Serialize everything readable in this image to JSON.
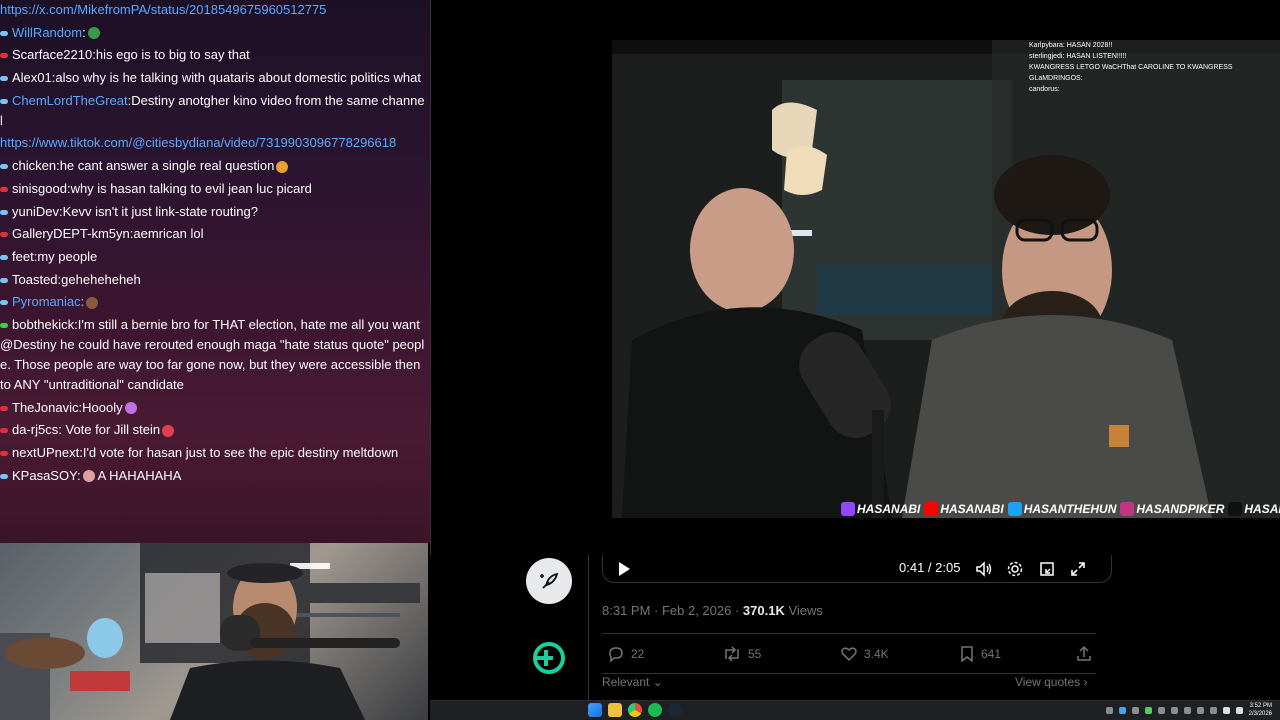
{
  "chat": {
    "lines": [
      {
        "badge": "none",
        "user": "",
        "user_hl": false,
        "text": "https://x.com/MikefromPA/status/2018549675960512775",
        "is_link": true
      },
      {
        "badge": "blue",
        "user": "WillRandom",
        "user_hl": true,
        "text": "",
        "emote": "green"
      },
      {
        "badge": "red",
        "user": "Scarface2210",
        "user_hl": false,
        "text": "his ego is to big to say that"
      },
      {
        "badge": "blue",
        "user": "Alex01",
        "user_hl": false,
        "text": "also why is he talking with quataris about domestic politics what"
      },
      {
        "badge": "blue",
        "user": "ChemLordTheGreat",
        "user_hl": true,
        "text": "Destiny anotgher kino video from the same channel"
      },
      {
        "badge": "none",
        "user": "",
        "user_hl": false,
        "text": "https://www.tiktok.com/@citiesbydiana/video/7319903096778296618",
        "is_link": true
      },
      {
        "badge": "blue",
        "user": "chicken",
        "user_hl": false,
        "text": "he cant answer a single real question",
        "emote": "orange"
      },
      {
        "badge": "red",
        "user": "sinisgood",
        "user_hl": false,
        "text": "why is hasan talking to evil jean luc picard"
      },
      {
        "badge": "blue",
        "user": "yuniDev",
        "user_hl": false,
        "text": "Kevv  isn't it just link-state routing?"
      },
      {
        "badge": "red",
        "user": "GalleryDEPT-km5yn",
        "user_hl": false,
        "text": "aemrican lol"
      },
      {
        "badge": "blue",
        "user": "feet",
        "user_hl": false,
        "text": "my people"
      },
      {
        "badge": "blue",
        "user": "Toasted",
        "user_hl": false,
        "text": "geheheheheh"
      },
      {
        "badge": "blue",
        "user": "Pyromaniac",
        "user_hl": true,
        "text": "",
        "emote": "brown"
      },
      {
        "badge": "green",
        "user": "bobthekick",
        "user_hl": false,
        "text": "I'm still a bernie bro for THAT election, hate me all you want @Destiny he could have rerouted enough maga \"hate status quote\" people. Those people are way too far gone now, but they were accessible then to ANY \"untraditional\" candidate"
      },
      {
        "badge": "red",
        "user": "TheJonavic",
        "user_hl": false,
        "text": "Hoooly",
        "emote": "purple"
      },
      {
        "badge": "red",
        "user": "da-rj5cs",
        "user_hl": false,
        "text": " Vote for Jill stein",
        "emote": "red"
      },
      {
        "badge": "red",
        "user": "nextUPnext",
        "user_hl": false,
        "text": "I'd vote for hasan just to see the epic destiny meltdown"
      },
      {
        "badge": "blue",
        "user": "KPasaSOY",
        "user_hl": false,
        "text": " A HAHAHAHA",
        "emote_before": "pink"
      }
    ]
  },
  "overlay_chat": [
    "Karlpybara: HASAN 2028!!",
    "sterlingjedi: HASAN LISTEN!!!!!",
    "KWANGRESS LETGO WaCHThat CAROLINE TO KWANGRESS",
    "GLaMDRINGOS:",
    "candorus:"
  ],
  "socials": [
    {
      "platform": "twitch-icon",
      "handle": "HASANABI",
      "color": "#9146ff"
    },
    {
      "platform": "youtube-icon",
      "handle": "HASANABI",
      "color": "#ff0000"
    },
    {
      "platform": "twitter-icon",
      "handle": "HASANTHEHUN",
      "color": "#1da1f2"
    },
    {
      "platform": "instagram-icon",
      "handle": "HASANDPIKER",
      "color": "#c13584"
    },
    {
      "platform": "tiktok-icon",
      "handle": "HASANDPIKER",
      "color": "#111111"
    }
  ],
  "video": {
    "time": "0:41 / 2:05"
  },
  "tweet": {
    "time": "8:31 PM · Feb 2, 2026 · ",
    "views_count": "370.1K",
    "views_label": " Views",
    "replies": "22",
    "reposts": "55",
    "likes": "3.4K",
    "bookmarks": "641",
    "relevant": "Relevant",
    "view_quotes": "View quotes"
  },
  "taskbar": {
    "time": "3:52 PM",
    "date": "2/3/2026"
  },
  "colors": {
    "link": "#5aa8ff",
    "muted": "#71767b"
  }
}
